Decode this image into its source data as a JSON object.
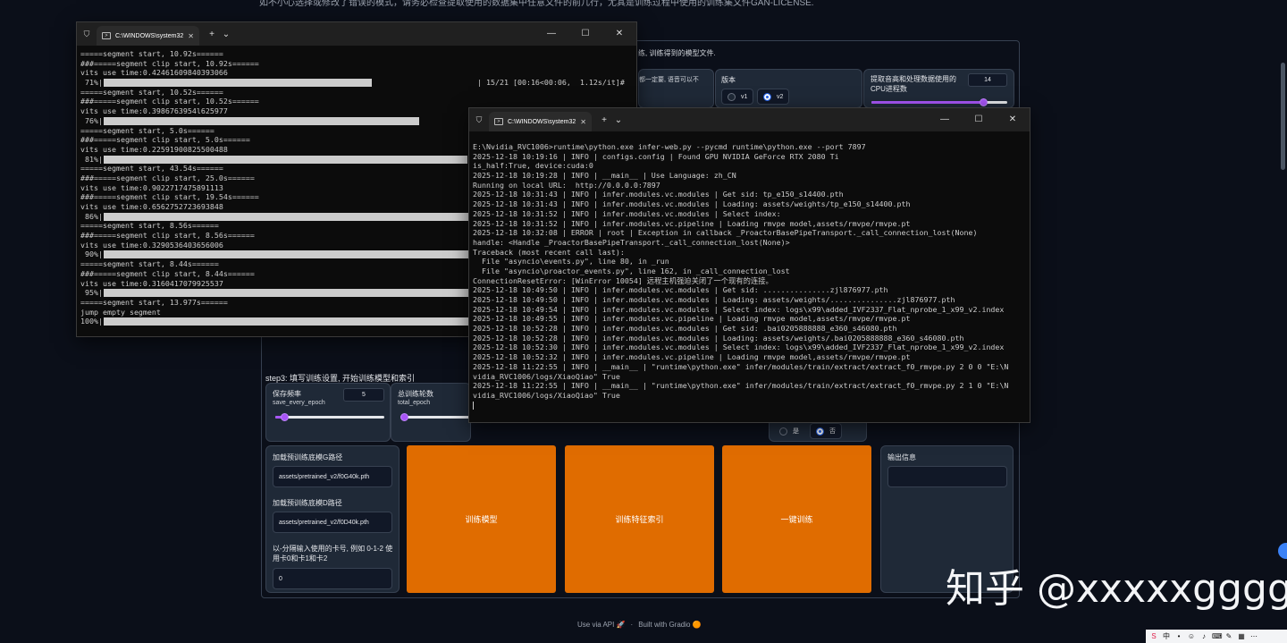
{
  "page": {
    "top_text": "如不小心选择或修改了错误的模式，请务必检查提取使用的数据集中任意文件的前几行，尤其是训练过程中使用的训练集文件GAN-LICENSE.",
    "partial_text_1": "练, 训练得到的模型文件.",
    "partial_text_2": "都一定要, 语音可以不",
    "version_label": "版本",
    "v1": "v1",
    "v2": "v2",
    "cpu_label": "提取音高和处理数据使用的CPU进程数",
    "cpu_value": "14",
    "cpu_slider_fraction": 0.82,
    "step3": "step3: 填写训练设置, 开始训练模型和索引",
    "save_freq_label": "保存频率",
    "save_freq_sub": "save_every_epoch",
    "save_freq_value": "5",
    "save_freq_slider_fraction": 0.08,
    "total_epoch_label": "总训练轮数",
    "total_epoch_sub": "total_epoch",
    "total_epoch_slider_fraction": 0.05,
    "yes": "是",
    "no": "否",
    "pretrained_g_label": "加载预训练底模G路径",
    "pretrained_g_value": "assets/pretrained_v2/f0G40k.pth",
    "pretrained_d_label": "加载预训练底模D路径",
    "pretrained_d_value": "assets/pretrained_v2/f0D40k.pth",
    "gpu_label": "以-分隔输入使用的卡号, 例如 0-1-2 使用卡0和卡1和卡2",
    "gpu_value": "0",
    "btn_train": "训练模型",
    "btn_index": "训练特征索引",
    "btn_oneclick": "一键训练",
    "output_label": "输出信息",
    "footer_api": "Use via API 🚀",
    "footer_dot": "·",
    "footer_gradio": "Built with Gradio 🟠",
    "watermark": "知乎 @xxxxxgggg"
  },
  "colors": {
    "orange": "#e06c00",
    "accent": "#a855f7",
    "terminal_bg": "#0c0c0c"
  },
  "win1": {
    "tab_title": "C:\\WINDOWS\\system32\\cmd.",
    "lines": [
      {
        "t": "=====segment start, 10.92s======"
      },
      {
        "t": "###=====segment clip start, 10.92s======"
      },
      {
        "t": "vits use time:0.42461609840393066"
      },
      {
        "t": " 71%|",
        "bar": 0.71,
        "right": "| 15/21 [00:16<00:06,  1.12s/it]#"
      },
      {
        "t": "=====segment start, 10.52s======"
      },
      {
        "t": "###=====segment clip start, 10.52s======"
      },
      {
        "t": "vits use time:0.3986763954l625977"
      },
      {
        "t": " 76%|",
        "bar": 0.76
      },
      {
        "t": "=====segment start, 5.0s======"
      },
      {
        "t": "###=====segment clip start, 5.0s======"
      },
      {
        "t": "vits use time:0.22591900825500488"
      },
      {
        "t": " 81%|",
        "bar": 0.81
      },
      {
        "t": "=====segment start, 43.54s======"
      },
      {
        "t": "###=====segment clip start, 25.0s======"
      },
      {
        "t": "vits use time:0.9022717475891113"
      },
      {
        "t": "###=====segment clip start, 19.54s======"
      },
      {
        "t": "vits use time:0.6562752723693848"
      },
      {
        "t": " 86%|",
        "bar": 0.86
      },
      {
        "t": "=====segment start, 8.56s======"
      },
      {
        "t": "###=====segment clip start, 8.56s======"
      },
      {
        "t": "vits use time:0.3290536403656006"
      },
      {
        "t": " 90%|",
        "bar": 0.9
      },
      {
        "t": "=====segment start, 8.44s======"
      },
      {
        "t": "###=====segment clip start, 8.44s======"
      },
      {
        "t": "vits use time:0.3160417079925537"
      },
      {
        "t": " 95%|",
        "bar": 0.95
      },
      {
        "t": "=====segment start, 13.977s======"
      },
      {
        "t": "jump empty segment"
      },
      {
        "t": "100%|",
        "bar": 1.0
      }
    ]
  },
  "win2": {
    "tab_title": "C:\\WINDOWS\\system32\\cmd.",
    "lines": [
      "E:\\Nvidia_RVC1006>runtime\\python.exe infer-web.py --pycmd runtime\\python.exe --port 7897",
      "2025-12-18 10:19:16 | INFO | configs.config | Found GPU NVIDIA GeForce RTX 2080 Ti",
      "is_half:True, device:cuda:0",
      "2025-12-18 10:19:28 | INFO | __main__ | Use Language: zh_CN",
      "Running on local URL:  http://0.0.0.0:7897",
      "2025-12-18 10:31:43 | INFO | infer.modules.vc.modules | Get sid: tp_e150_s14400.pth",
      "2025-12-18 10:31:43 | INFO | infer.modules.vc.modules | Loading: assets/weights/tp_e150_s14400.pth",
      "2025-12-18 10:31:52 | INFO | infer.modules.vc.modules | Select index:",
      "2025-12-18 10:31:52 | INFO | infer.modules.vc.pipeline | Loading rmvpe model,assets/rmvpe/rmvpe.pt",
      "2025-12-18 10:32:08 | ERROR | root | Exception in callback _ProactorBasePipeTransport._call_connection_lost(None)",
      "handle: <Handle _ProactorBasePipeTransport._call_connection_lost(None)>",
      "Traceback (most recent call last):",
      "  File \"asyncio\\events.py\", line 80, in _run",
      "  File \"asyncio\\proactor_events.py\", line 162, in _call_connection_lost",
      "ConnectionResetError: [WinError 10054] 远程主机强迫关闭了一个现有的连接。",
      "2025-12-18 10:49:50 | INFO | infer.modules.vc.modules | Get sid: ...............zjl876977.pth",
      "2025-12-18 10:49:50 | INFO | infer.modules.vc.modules | Loading: assets/weights/...............zjl876977.pth",
      "2025-12-18 10:49:54 | INFO | infer.modules.vc.modules | Select index: logs\\x99\\added_IVF2337_Flat_nprobe_1_x99_v2.index",
      "2025-12-18 10:49:55 | INFO | infer.modules.vc.pipeline | Loading rmvpe model,assets/rmvpe/rmvpe.pt",
      "2025-12-18 10:52:28 | INFO | infer.modules.vc.modules | Get sid: .bai0205888888_e360_s46080.pth",
      "2025-12-18 10:52:28 | INFO | infer.modules.vc.modules | Loading: assets/weights/.bai0205888888_e360_s46080.pth",
      "2025-12-18 10:52:30 | INFO | infer.modules.vc.modules | Select index: logs\\x99\\added_IVF2337_Flat_nprobe_1_x99_v2.index",
      "2025-12-18 10:52:32 | INFO | infer.modules.vc.pipeline | Loading rmvpe model,assets/rmvpe/rmvpe.pt",
      "2025-12-18 11:22:55 | INFO | __main__ | \"runtime\\python.exe\" infer/modules/train/extract/extract_f0_rmvpe.py 2 0 0 \"E:\\N",
      "vidia_RVC1006/logs/XiaoQiao\" True",
      "2025-12-18 11:22:55 | INFO | __main__ | \"runtime\\python.exe\" infer/modules/train/extract/extract_f0_rmvpe.py 2 1 0 \"E:\\N",
      "vidia_RVC1006/logs/XiaoQiao\" True"
    ]
  }
}
